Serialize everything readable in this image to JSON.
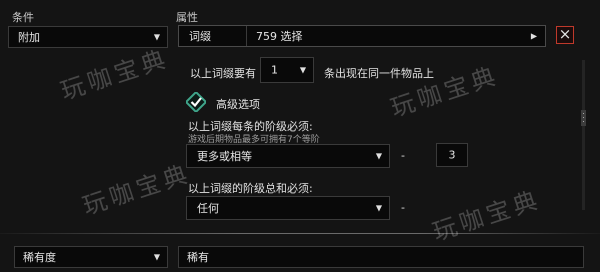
{
  "headers": {
    "condition": "条件",
    "property": "属性"
  },
  "condition_select": {
    "value": "附加"
  },
  "affix_row": {
    "label": "词缀",
    "value": "759 选择"
  },
  "close_icon": "×",
  "count_row": {
    "prefix": "以上词缀要有",
    "value": "1",
    "suffix": "条出现在同一件物品上"
  },
  "advanced_checkbox": {
    "label": "高级选项",
    "checked": true
  },
  "tier_each": {
    "label": "以上词缀每条的阶级必须:",
    "hint": "游戏后期物品最多可拥有7个等阶",
    "select_value": "更多或相等",
    "dash": "-",
    "number": "3"
  },
  "tier_sum": {
    "label": "以上词缀的阶级总和必须:",
    "select_value": "任何",
    "dash": "-"
  },
  "rarity_row": {
    "left_value": "稀有度",
    "right_value": "稀有"
  },
  "watermarks": [
    "玩咖宝典",
    "玩咖宝典",
    "玩咖宝典",
    "玩咖宝典"
  ],
  "colors": {
    "accent_check": "#3fa58a",
    "close_border": "#b83a3a",
    "background": "#141414"
  }
}
